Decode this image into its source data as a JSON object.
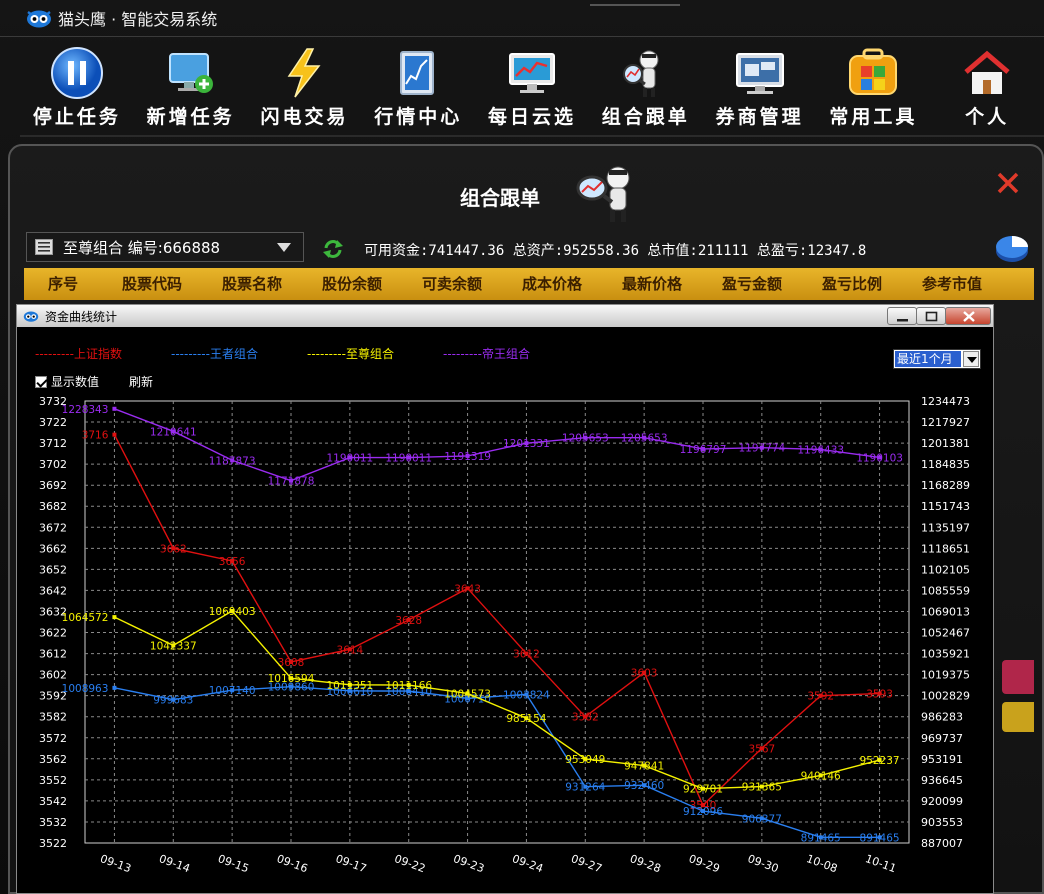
{
  "app": {
    "title": "猫头鹰 · 智能交易系统"
  },
  "toolbar": {
    "items": [
      {
        "label": "停止任务",
        "icon": "pause-icon"
      },
      {
        "label": "新增任务",
        "icon": "add-monitor-icon"
      },
      {
        "label": "闪电交易",
        "icon": "lightning-icon"
      },
      {
        "label": "行情中心",
        "icon": "market-chart-icon"
      },
      {
        "label": "每日云选",
        "icon": "daily-pick-icon"
      },
      {
        "label": "组合跟单",
        "icon": "mascot-icon"
      },
      {
        "label": "券商管理",
        "icon": "broker-icon"
      },
      {
        "label": "常用工具",
        "icon": "tools-icon"
      },
      {
        "label": "个人",
        "icon": "home-icon"
      }
    ]
  },
  "panel": {
    "title": "组合跟单",
    "combo_select": "至尊组合  编号:666888",
    "fund_info": "可用资金:741447.36 总资产:952558.36 总市值:211111 总盈亏:12347.8",
    "table_headers": [
      "序号",
      "股票代码",
      "股票名称",
      "股份余额",
      "可卖余额",
      "成本价格",
      "最新价格",
      "盈亏金额",
      "盈亏比例",
      "参考市值"
    ]
  },
  "window": {
    "title": "资金曲线统计",
    "show_values_label": "显示数值",
    "refresh_label": "刷新",
    "range_value": "最近1个月"
  },
  "colors": {
    "series_1": "#e01010",
    "series_2": "#2a7ff0",
    "series_3": "#f5f200",
    "series_4": "#9a2cf0",
    "accent": "#e0a820"
  },
  "chart_data": {
    "type": "line",
    "categories": [
      "09-13",
      "09-14",
      "09-15",
      "09-16",
      "09-17",
      "09-22",
      "09-23",
      "09-24",
      "09-27",
      "09-28",
      "09-29",
      "09-30",
      "10-08",
      "10-11"
    ],
    "y_left_ticks": [
      3732,
      3722,
      3712,
      3702,
      3692,
      3682,
      3672,
      3662,
      3652,
      3642,
      3632,
      3622,
      3612,
      3602,
      3592,
      3582,
      3572,
      3562,
      3552,
      3542,
      3532,
      3522
    ],
    "y_right_ticks": [
      1234473,
      1217927,
      1201381,
      1184835,
      1168289,
      1151743,
      1135197,
      1118651,
      1102105,
      1085559,
      1069013,
      1052467,
      1035921,
      1019375,
      1002829,
      986283,
      969737,
      953191,
      936645,
      920099,
      903553,
      887007
    ],
    "ylim_left": [
      3522,
      3732
    ],
    "ylim_right": [
      887007,
      1234473
    ],
    "grid": true,
    "series": [
      {
        "name": "上证指数",
        "axis": "left",
        "legend": "---------上证指数",
        "values": [
          3716,
          3662,
          3656,
          3608,
          3614,
          3628,
          3643,
          3612,
          3582,
          3603,
          3540,
          3567,
          3592,
          3593
        ]
      },
      {
        "name": "王者组合",
        "axis": "right",
        "legend": "---------王者组合",
        "values": [
          1008963,
          999683,
          1007140,
          1009860,
          1006610,
          1006410,
          1000710,
          1003824,
          931264,
          932460,
          912096,
          906377,
          891465,
          891465
        ]
      },
      {
        "name": "至尊组合",
        "axis": "right",
        "legend": "---------至尊组合",
        "values": [
          1064572,
          1042337,
          1069403,
          1016594,
          1011351,
          1011166,
          1004573,
          985154,
          953049,
          947841,
          929701,
          931365,
          940146,
          952237
        ]
      },
      {
        "name": "帝王组合",
        "axis": "right",
        "legend": "---------帝王组合",
        "values": [
          1228343,
          1210641,
          1187873,
          1171878,
          1190011,
          1190011,
          1191319,
          1201331,
          1205653,
          1205653,
          1196797,
          1197774,
          1196433,
          1190103
        ]
      }
    ]
  }
}
